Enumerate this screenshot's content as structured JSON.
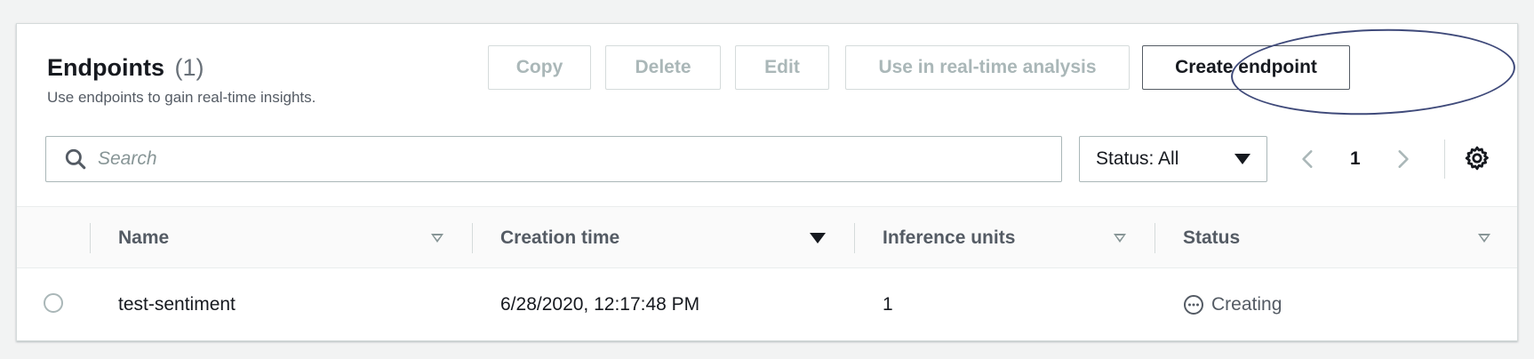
{
  "header": {
    "title": "Endpoints",
    "count": "(1)",
    "description": "Use endpoints to gain real-time insights."
  },
  "toolbar": {
    "copy_label": "Copy",
    "delete_label": "Delete",
    "edit_label": "Edit",
    "analysis_label": "Use in real-time analysis",
    "create_label": "Create endpoint"
  },
  "filter": {
    "search_placeholder": "Search",
    "search_value": "",
    "status_select": "Status: All"
  },
  "pagination": {
    "current_page": "1"
  },
  "table": {
    "columns": [
      "Name",
      "Creation time",
      "Inference units",
      "Status"
    ],
    "rows": [
      {
        "name": "test-sentiment",
        "creation_time": "6/28/2020, 12:17:48 PM",
        "inference_units": "1",
        "status": "Creating"
      }
    ]
  },
  "icons": {
    "search": "search-icon",
    "dropdown": "caret-down-icon",
    "prev": "chevron-left-icon",
    "next": "chevron-right-icon",
    "settings": "gear-icon",
    "status": "ellipsis-circle-icon"
  },
  "colors": {
    "disabled_text": "#aab7b8",
    "primary_text": "#16191f",
    "secondary_text": "#545b64",
    "annotation": "#3f4a7a"
  }
}
